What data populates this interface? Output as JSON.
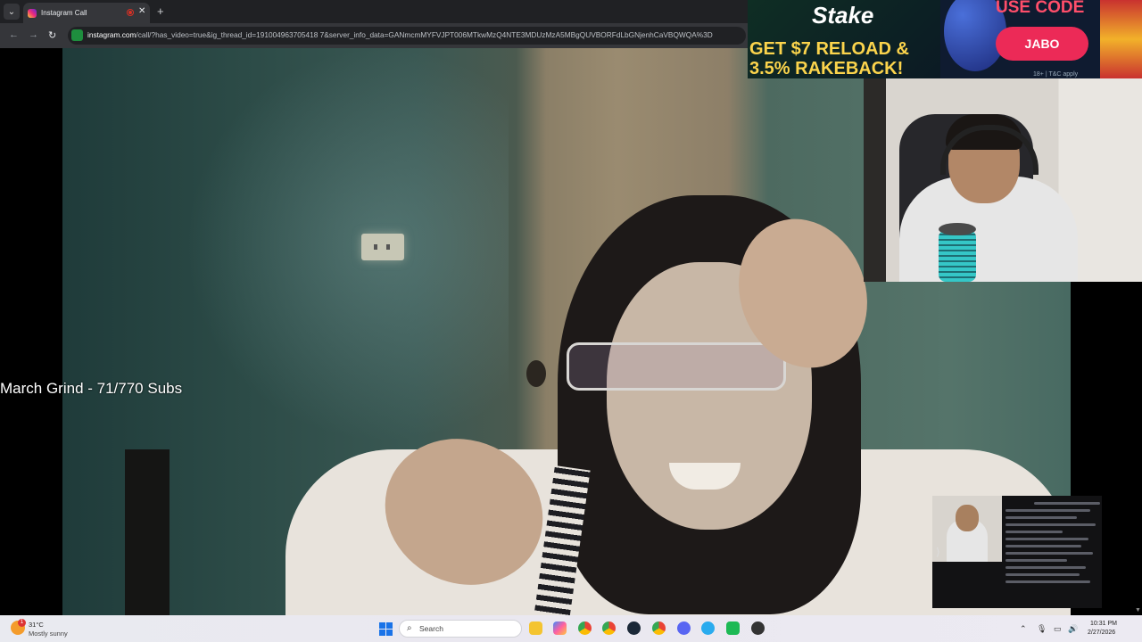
{
  "browser": {
    "tab_title": "Instagram Call",
    "close_label": "✕",
    "new_tab_label": "+",
    "menu_label": "⌄",
    "nav_back": "←",
    "nav_forward": "→",
    "nav_reload": "↻",
    "url_domain": "instagram.com",
    "url_path": "/call/?has_video=true&ig_thread_id=191004963705418 7&server_info_data=GANmcmMYFVJPT006MTkwMzQ4NTE3MDUzMzA5MBgQUVBORFdLbGNjenhCaVBQWQA%3D"
  },
  "overlay": {
    "goal_text": "March Grind - 71/770 Subs"
  },
  "ad": {
    "logo": "Stake",
    "line1": "GET $7 RELOAD &",
    "line2": "3.5% RAKEBACK!",
    "code_label": "USE CODE",
    "code_value": "JABO",
    "terms": "18+ | T&C apply"
  },
  "mini_player": {
    "arrow": "⟩"
  },
  "taskbar": {
    "weather_temp": "31°C",
    "weather_desc": "Mostly sunny",
    "weather_badge": "1",
    "search_placeholder": "Search",
    "search_icon": "⌕",
    "clock_time": "10:31 PM",
    "clock_date": "2/27/2026",
    "tray_chevron": "⌃",
    "tray_mic": "🎙",
    "tray_wifi": "▭",
    "tray_volume": "🔊"
  },
  "colors": {
    "accent": "#ec2a57",
    "ad_yellow": "#fbd44c",
    "chrome_dark": "#202124"
  }
}
